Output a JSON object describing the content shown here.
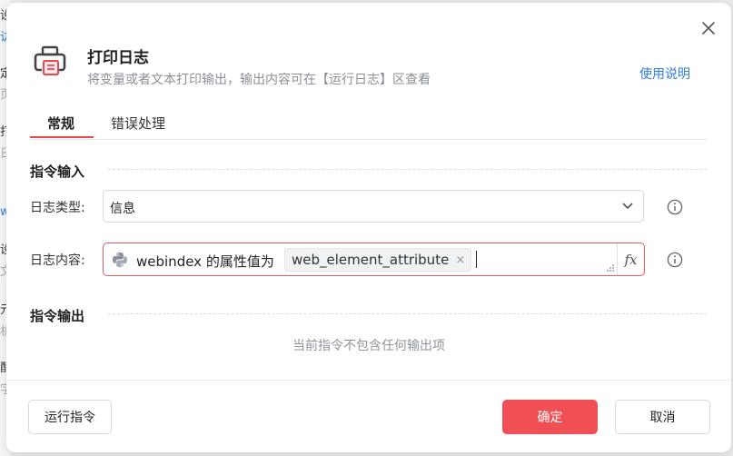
{
  "background": {
    "glyphs": [
      "设",
      "访",
      "定",
      "页",
      "打",
      "日",
      "w",
      "设",
      "文",
      "元",
      "机",
      "配",
      "字"
    ]
  },
  "dialog": {
    "title": "打印日志",
    "subtitle": "将变量或者文本打印输出，输出内容可在【运行日志】区查看",
    "help_link": "使用说明",
    "tabs": [
      {
        "label": "常规",
        "active": true
      },
      {
        "label": "错误处理",
        "active": false
      }
    ],
    "input_section": {
      "title": "指令输入",
      "log_type": {
        "label": "日志类型:",
        "value": "信息"
      },
      "log_content": {
        "label": "日志内容:",
        "text": "webindex 的属性值为",
        "variable_tag": "web_element_attribute",
        "tag_remove": "×",
        "fx_button": "fx"
      }
    },
    "output_section": {
      "title": "指令输出",
      "empty_note": "当前指令不包含任何输出项"
    },
    "buttons": {
      "run": "运行指令",
      "confirm": "确定",
      "cancel": "取消"
    }
  },
  "colors": {
    "accent": "#f05055",
    "link": "#2f7cd9",
    "error_border": "#e35a5f"
  }
}
